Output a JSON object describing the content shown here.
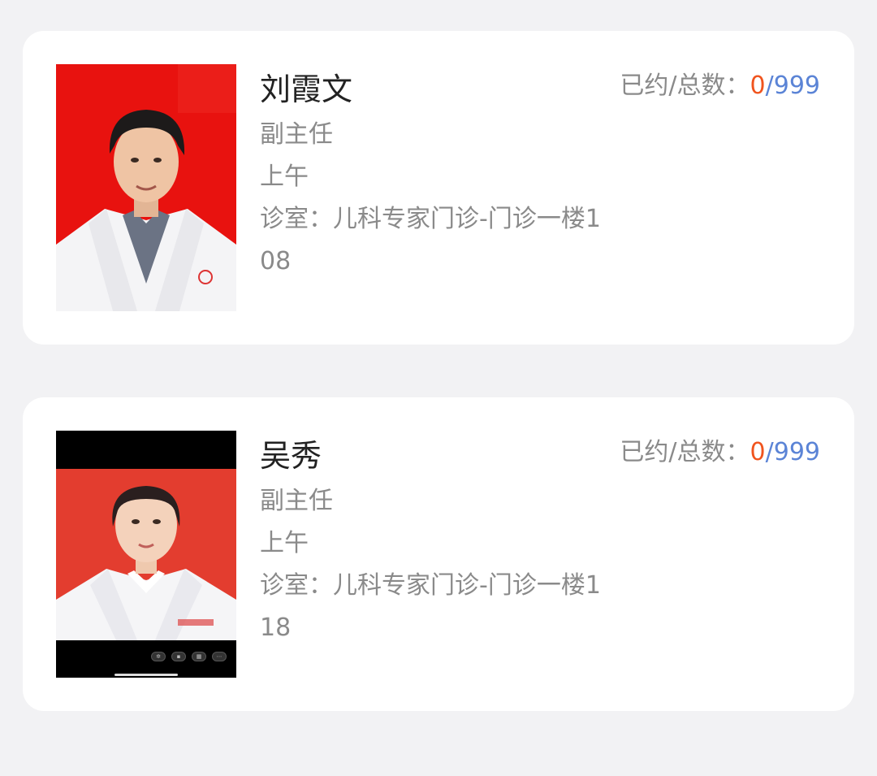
{
  "colors": {
    "background": "#f2f2f4",
    "card": "#ffffff",
    "booked_accent": "#f0541e",
    "total_accent": "#5b84d6",
    "photo_red": "#e8120f",
    "photo_red_2": "#e33d2f"
  },
  "doctors": [
    {
      "name": "刘霞文",
      "title": "副主任",
      "session": "上午",
      "room": "诊室：儿科专家门诊-门诊一楼108",
      "count_label": "已约/总数：",
      "booked": "0",
      "separator": "/",
      "total": "999"
    },
    {
      "name": "吴秀",
      "title": "副主任",
      "session": "上午",
      "room": "诊室：儿科专家门诊-门诊一楼118",
      "count_label": "已约/总数：",
      "booked": "0",
      "separator": "/",
      "total": "999"
    }
  ]
}
